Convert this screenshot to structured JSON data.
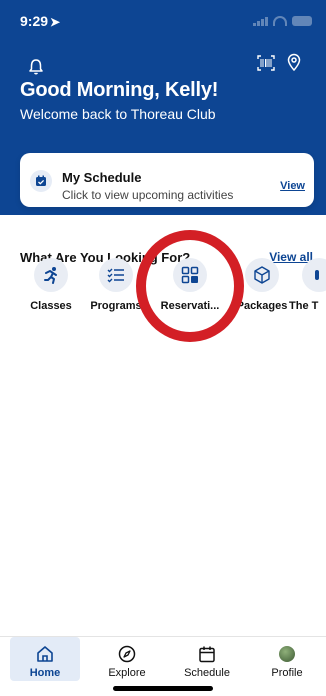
{
  "status_bar": {
    "time": "9:29",
    "location_arrow": "location-arrow-icon"
  },
  "header": {
    "greeting": "Good Morning, Kelly!",
    "welcome": "Welcome back to Thoreau Club",
    "bell_icon": "bell-icon",
    "scan_icon": "barcode-scan-icon",
    "location_icon": "map-pin-icon"
  },
  "schedule_card": {
    "title": "My Schedule",
    "subtitle": "Click to view upcoming activities",
    "view": "View",
    "icon": "calendar-check-icon"
  },
  "section": {
    "title": "What Are You Looking For?",
    "view_all": "View all"
  },
  "categories": [
    {
      "label": "Classes",
      "icon": "runner-icon"
    },
    {
      "label": "Programs",
      "icon": "checklist-icon"
    },
    {
      "label": "Reservati...",
      "icon": "grid-icon"
    },
    {
      "label": "Packages",
      "icon": "package-icon"
    },
    {
      "label": "The T",
      "icon": "partial-icon"
    }
  ],
  "tabbar": {
    "tabs": [
      {
        "label": "Home",
        "icon": "home-icon",
        "active": true
      },
      {
        "label": "Explore",
        "icon": "compass-icon",
        "active": false
      },
      {
        "label": "Schedule",
        "icon": "calendar-icon",
        "active": false
      },
      {
        "label": "Profile",
        "icon": "avatar",
        "active": false
      }
    ]
  },
  "colors": {
    "brand": "#0d4593",
    "highlight": "#d31f25",
    "chip": "#e9edf4"
  }
}
